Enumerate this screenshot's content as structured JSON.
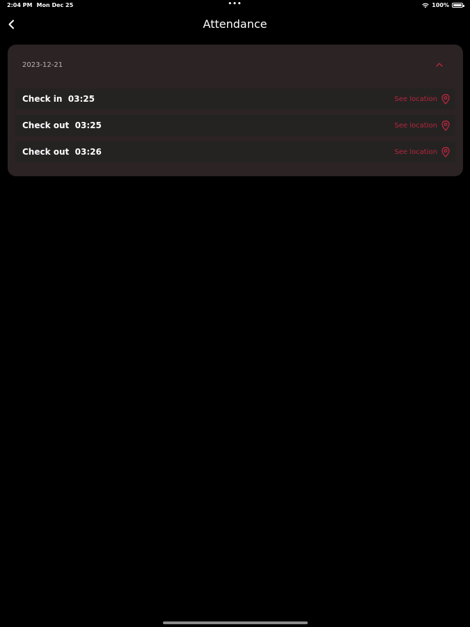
{
  "status_bar": {
    "time": "2:04 PM",
    "date": "Mon Dec 25",
    "dots": "•••",
    "battery_percent": "100%"
  },
  "header": {
    "title": "Attendance",
    "back_icon": "chevron-left-icon"
  },
  "card": {
    "date": "2023-12-21",
    "expanded": true,
    "toggle_icon": "chevron-up-icon",
    "entries": [
      {
        "label": "Check in  03:25",
        "action": "See location",
        "icon": "location-pin-icon"
      },
      {
        "label": "Check out  03:25",
        "action": "See location",
        "icon": "location-pin-icon"
      },
      {
        "label": "Check out  03:26",
        "action": "See location",
        "icon": "location-pin-icon"
      }
    ]
  },
  "colors": {
    "background": "#000000",
    "card": "#2b2324",
    "row": "#252222",
    "accent": "#b3283d",
    "text": "#ffffff",
    "muted": "#bdb5b6"
  }
}
